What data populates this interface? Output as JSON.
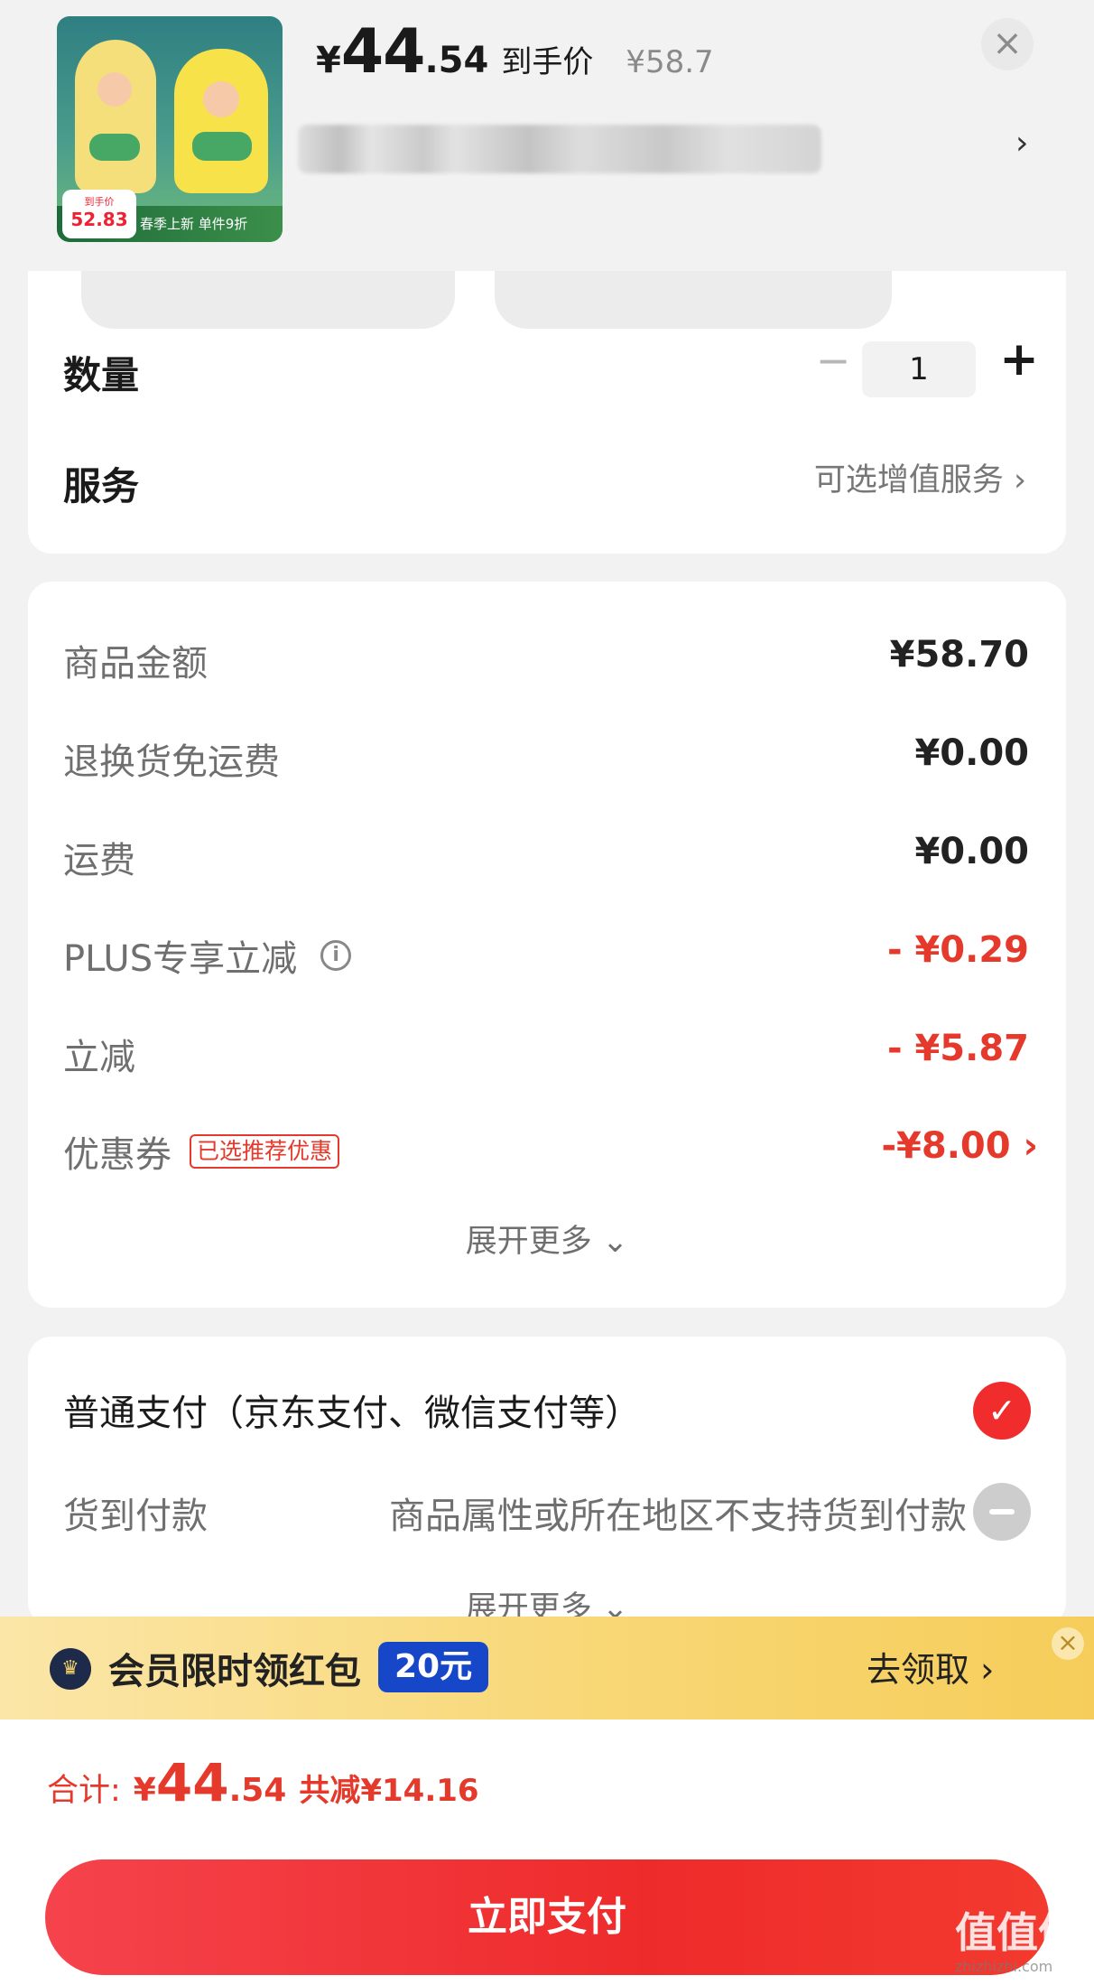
{
  "header": {
    "thumb_badge_label": "到手价",
    "thumb_badge_price": "52.83",
    "thumb_strip": "春季上新 单件9折",
    "price_symbol": "¥",
    "price_int": "44",
    "price_dec": ".54",
    "price_label": "到手价",
    "original_price": "¥58.7",
    "close_icon": "×",
    "address_arrow": "›"
  },
  "quantity": {
    "label": "数量",
    "minus": "−",
    "value": "1",
    "plus": "+"
  },
  "service": {
    "label": "服务",
    "value": "可选增值服务 ›"
  },
  "fees": [
    {
      "label": "商品金额",
      "value": "¥58.70"
    },
    {
      "label": "退换货免运费",
      "value": "¥0.00"
    },
    {
      "label": "运费",
      "value": "¥0.00"
    },
    {
      "label": "PLUS专享立减",
      "value": "- ¥0.29"
    },
    {
      "label": "立减",
      "value": "- ¥5.87"
    },
    {
      "label": "优惠券",
      "tag": "已选推荐优惠",
      "value": "-¥8.00 ›"
    }
  ],
  "fees_expand": "展开更多 ⌄",
  "payment": {
    "normal_label": "普通支付（京东支付、微信支付等）",
    "cod_label": "货到付款",
    "cod_note": "商品属性或所在地区不支持货到付款",
    "expand": "展开更多 ⌄"
  },
  "banner": {
    "text": "会员限时领红包",
    "badge": "20元",
    "action": "去领取 ›",
    "close": "×"
  },
  "footer": {
    "total_label": "合计:",
    "total_symbol": "¥",
    "total_int": "44",
    "total_dec": ".54",
    "saved": "共减¥14.16",
    "pay_button": "立即支付"
  },
  "watermark": {
    "text": "值值值",
    "sub": "zhizhizhi.com"
  }
}
